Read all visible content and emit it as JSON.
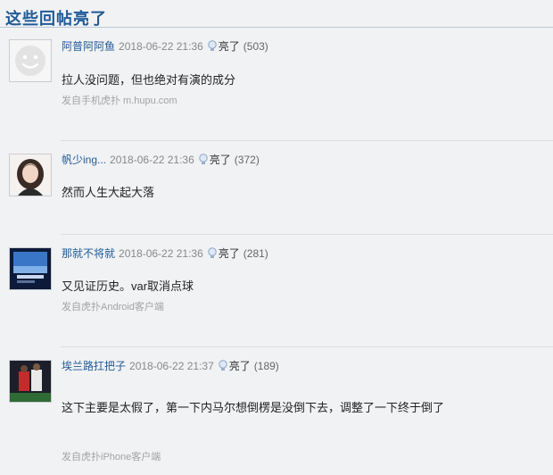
{
  "section": {
    "title": "这些回帖亮了"
  },
  "posts": [
    {
      "username": "阿普阿阿鱼",
      "time": "2018-06-22 21:36",
      "light_label": "亮了",
      "light_count": "(503)",
      "content": "拉人没问题，但也绝对有演的成分",
      "source": "发自手机虎扑 m.hupu.com",
      "avatar": "default-face-avatar"
    },
    {
      "username": "帆少ing...",
      "time": "2018-06-22 21:36",
      "light_label": "亮了",
      "light_count": "(372)",
      "content": "然而人生大起大落",
      "source": "",
      "avatar": "girl-photo-avatar"
    },
    {
      "username": "那就不将就",
      "time": "2018-06-22 21:36",
      "light_label": "亮了",
      "light_count": "(281)",
      "content": "又见证历史。var取消点球",
      "source": "发自虎扑Android客户端",
      "avatar": "blue-poster-avatar"
    },
    {
      "username": "埃兰路扛把子",
      "time": "2018-06-22 21:37",
      "light_label": "亮了",
      "light_count": "(189)",
      "content": "这下主要是太假了，第一下内马尔想倒楞是没倒下去，调整了一下终于倒了",
      "source": "发自虎扑iPhone客户端",
      "avatar": "football-photo-avatar"
    }
  ]
}
